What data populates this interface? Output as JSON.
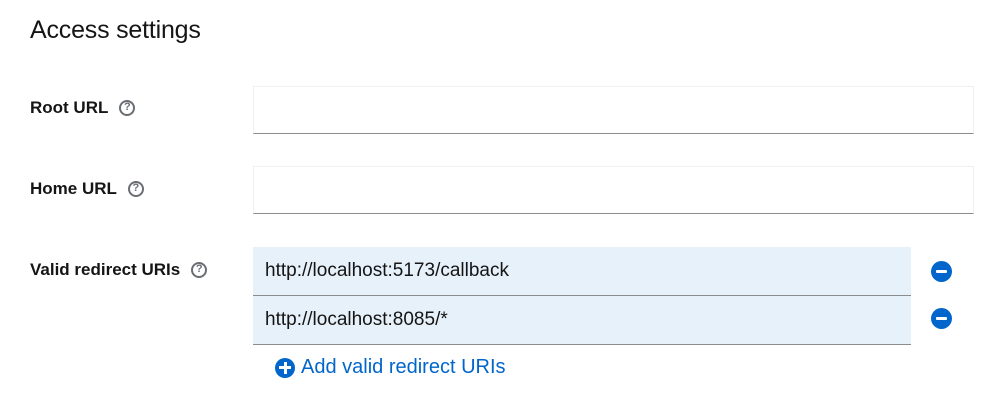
{
  "section": {
    "title": "Access settings"
  },
  "fields": {
    "root_url": {
      "label": "Root URL",
      "value": ""
    },
    "home_url": {
      "label": "Home URL",
      "value": ""
    },
    "redirect_uris": {
      "label": "Valid redirect URIs",
      "items": [
        "http://localhost:5173/callback",
        "http://localhost:8085/*"
      ],
      "add_label": "Add valid redirect URIs"
    }
  },
  "icons": {
    "help": "help-circle-icon",
    "remove": "minus-circle-icon",
    "add": "plus-circle-icon"
  },
  "colors": {
    "link": "#0066cc",
    "uri_row_bg": "#e7f1fa",
    "text": "#151515"
  }
}
